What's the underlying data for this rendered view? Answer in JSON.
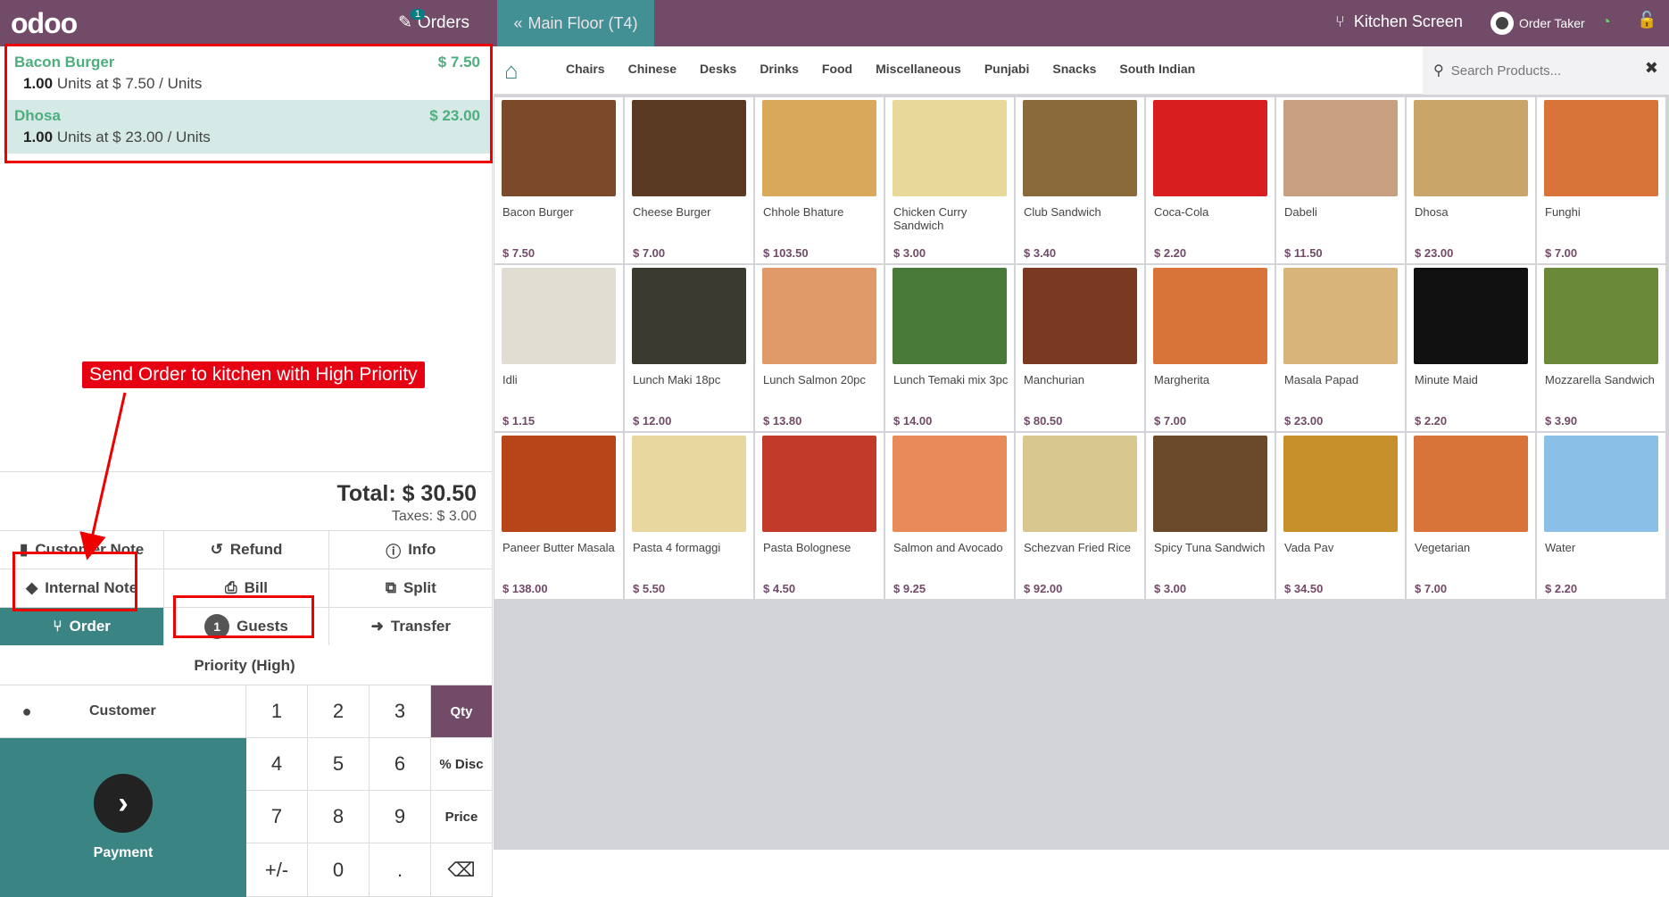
{
  "navbar": {
    "logo": "odoo",
    "orders_label": "Orders",
    "orders_count": "1",
    "floor_label": "Main Floor  (T4)",
    "kitchen_label": "Kitchen Screen",
    "user_label": "Order Taker"
  },
  "order": {
    "lines": [
      {
        "name": "Bacon Burger",
        "price": "$ 7.50",
        "qty": "1.00",
        "info": " Units at $ 7.50 / Units"
      },
      {
        "name": "Dhosa",
        "price": "$ 23.00",
        "qty": "1.00",
        "info": " Units at $ 23.00 / Units"
      }
    ],
    "total": "Total: $ 30.50",
    "taxes": "Taxes: $ 3.00"
  },
  "annotation": {
    "callout": "Send Order to kitchen with High Priority"
  },
  "controls": {
    "customer_note": "Customer Note",
    "refund": "Refund",
    "info": "Info",
    "internal_note": "Internal Note",
    "bill": "Bill",
    "split": "Split",
    "order": "Order",
    "guests_count": "1",
    "guests": "Guests",
    "transfer": "Transfer",
    "priority": "Priority (High)"
  },
  "pad": {
    "customer": "Customer",
    "payment": "Payment",
    "keys": [
      "1",
      "2",
      "3",
      "Qty",
      "4",
      "5",
      "6",
      "% Disc",
      "7",
      "8",
      "9",
      "Price",
      "+/-",
      "0",
      ".",
      "⌫"
    ]
  },
  "categories": [
    "Chairs",
    "Chinese",
    "Desks",
    "Drinks",
    "Food",
    "Miscellaneous",
    "Punjabi",
    "Snacks",
    "South Indian"
  ],
  "search": {
    "placeholder": "Search Products..."
  },
  "products": [
    {
      "name": "Bacon Burger",
      "price": "$ 7.50",
      "color": "#7a4a2a"
    },
    {
      "name": "Cheese Burger",
      "price": "$ 7.00",
      "color": "#5a3a22"
    },
    {
      "name": "Chhole Bhature",
      "price": "$ 103.50",
      "color": "#d9a85a"
    },
    {
      "name": "Chicken Curry Sandwich",
      "price": "$ 3.00",
      "color": "#e8d89a"
    },
    {
      "name": "Club Sandwich",
      "price": "$ 3.40",
      "color": "#8a6a3a"
    },
    {
      "name": "Coca-Cola",
      "price": "$ 2.20",
      "color": "#d81e1e"
    },
    {
      "name": "Dabeli",
      "price": "$ 11.50",
      "color": "#c7a080"
    },
    {
      "name": "Dhosa",
      "price": "$ 23.00",
      "color": "#caa56a"
    },
    {
      "name": "Funghi",
      "price": "$ 7.00",
      "color": "#d8743a"
    },
    {
      "name": "Idli",
      "price": "$ 1.15",
      "color": "#e2ddd2"
    },
    {
      "name": "Lunch Maki 18pc",
      "price": "$ 12.00",
      "color": "#3a3a30"
    },
    {
      "name": "Lunch Salmon 20pc",
      "price": "$ 13.80",
      "color": "#e09a6a"
    },
    {
      "name": "Lunch Temaki mix 3pc",
      "price": "$ 14.00",
      "color": "#4a7a3a"
    },
    {
      "name": "Manchurian",
      "price": "$ 80.50",
      "color": "#7a3a22"
    },
    {
      "name": "Margherita",
      "price": "$ 7.00",
      "color": "#d8743a"
    },
    {
      "name": "Masala Papad",
      "price": "$ 23.00",
      "color": "#d8b47a"
    },
    {
      "name": "Minute Maid",
      "price": "$ 2.20",
      "color": "#111111"
    },
    {
      "name": "Mozzarella Sandwich",
      "price": "$ 3.90",
      "color": "#6a8a3a"
    },
    {
      "name": "Paneer Butter Masala",
      "price": "$ 138.00",
      "color": "#b8441a"
    },
    {
      "name": "Pasta 4 formaggi",
      "price": "$ 5.50",
      "color": "#e8d8a0"
    },
    {
      "name": "Pasta Bolognese",
      "price": "$ 4.50",
      "color": "#c23a2a"
    },
    {
      "name": "Salmon and Avocado",
      "price": "$ 9.25",
      "color": "#e88a5a"
    },
    {
      "name": "Schezvan Fried Rice",
      "price": "$ 92.00",
      "color": "#d8c890"
    },
    {
      "name": "Spicy Tuna Sandwich",
      "price": "$ 3.00",
      "color": "#6a4a2a"
    },
    {
      "name": "Vada Pav",
      "price": "$ 34.50",
      "color": "#c8902a"
    },
    {
      "name": "Vegetarian",
      "price": "$ 7.00",
      "color": "#d8743a"
    },
    {
      "name": "Water",
      "price": "$ 2.20",
      "color": "#8ac0e8"
    }
  ],
  "colors": {
    "brand": "#714b67",
    "teal": "#3a8583",
    "price_green": "#4caf7d",
    "highlight_red": "#e60012"
  }
}
